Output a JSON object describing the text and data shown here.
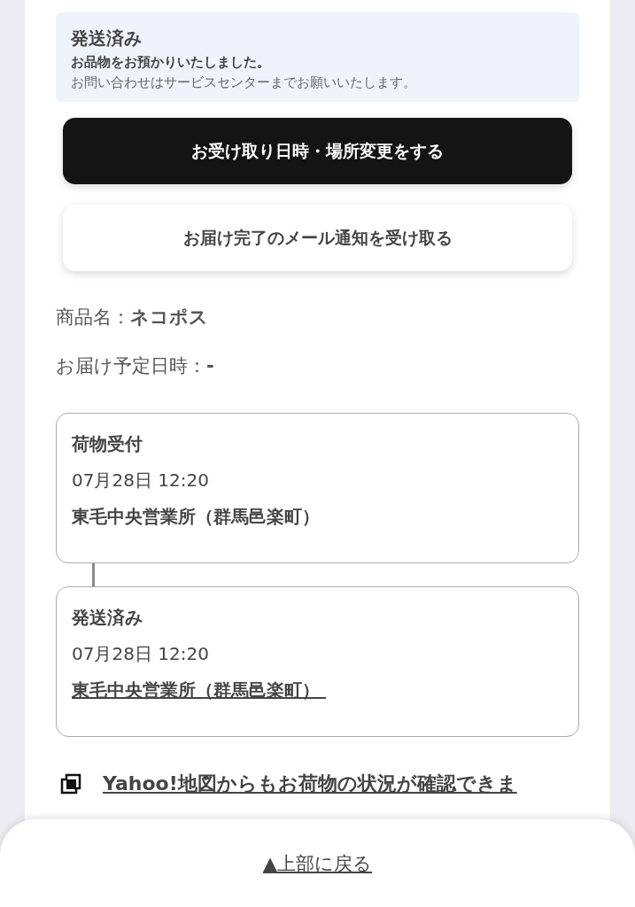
{
  "status_box": {
    "title": "発送済み",
    "message": "お品物をお預かりいたしました。",
    "note": "お問い合わせはサービスセンターまでお願いいたします。"
  },
  "buttons": [
    {
      "label": "お受け取り日時・場所変更をする",
      "kind": "primary"
    },
    {
      "label": "お届け完了のメール通知を受け取る",
      "kind": "secondary"
    }
  ],
  "details": [
    {
      "label": "商品名：",
      "value": "ネコポス"
    },
    {
      "label": "お届け予定日時：",
      "value": "-"
    }
  ],
  "timeline": [
    {
      "status": "荷物受付",
      "datetime": "07月28日 12:20",
      "location": "東毛中央営業所（群馬邑楽町）",
      "linked": false
    },
    {
      "status": "発送済み",
      "datetime": "07月28日 12:20",
      "location": "東毛中央営業所（群馬邑楽町）",
      "linked": true
    }
  ],
  "map_link": "Yahoo!地図からもお荷物の状況が確認できま",
  "back_to_top": "▲上部に戻る"
}
